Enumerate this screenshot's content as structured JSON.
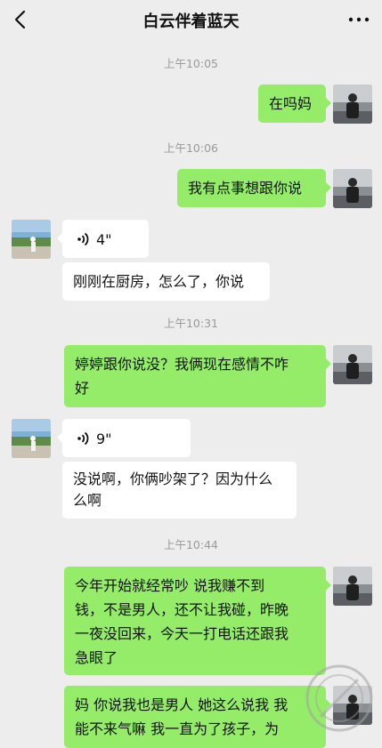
{
  "header": {
    "title": "白云伴着蓝天",
    "back_icon": "chevron-left-icon",
    "more_icon": "ellipsis-icon"
  },
  "colors": {
    "background": "#ededed",
    "sent_bubble": "#95ec69",
    "received_bubble": "#ffffff",
    "timestamp": "#9a9a9a"
  },
  "messages": {
    "t1": "上午10:05",
    "m1": "在吗妈",
    "t2": "上午10:06",
    "m2": "我有点事想跟你说",
    "v1": "4\"",
    "m3": "刚刚在厨房，怎么了，你说",
    "t3": "上午10:31",
    "m4_l1": "婷婷跟你说没？我俩现在感情不咋",
    "m4_l2": "好",
    "v2": "9\"",
    "m5_l1": "没说啊，你俩吵架了？因为什么",
    "m5_l2": "么啊",
    "t4": "上午10:44",
    "m6_l1": "今年开始就经常吵 说我赚不到",
    "m6_l2": "钱，不是男人，还不让我碰，昨晚",
    "m6_l3": "一夜没回来，今天一打电话还跟我",
    "m6_l4": "急眼了",
    "m7_l1": "妈 你说我也是男人 她这么说我 我",
    "m7_l2": "能不来气嘛 我一直为了孩子，为"
  }
}
